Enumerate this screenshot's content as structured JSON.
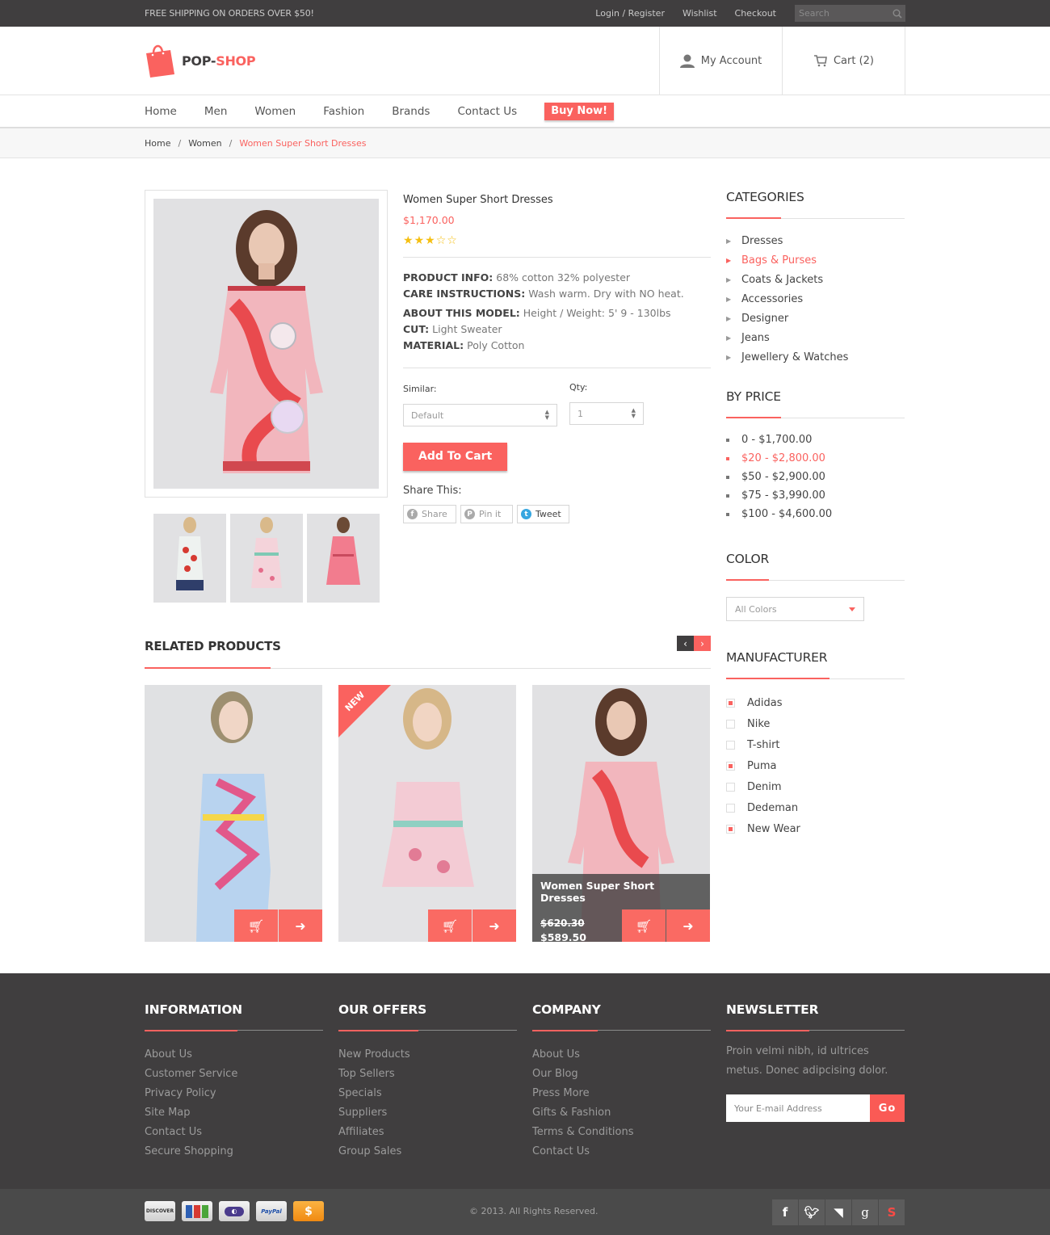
{
  "topbar": {
    "shipping": "FREE SHIPPING ON ORDERS OVER $50!",
    "links": [
      "Login / Register",
      "Wishlist",
      "Checkout"
    ],
    "search_placeholder": "Search"
  },
  "header": {
    "logo_dark": "POP-",
    "logo_accent": "SHOP",
    "account": "My Account",
    "cart": "Cart (2)"
  },
  "nav": {
    "items": [
      "Home",
      "Men",
      "Women",
      "Fashion",
      "Brands",
      "Contact Us"
    ],
    "buy_now": "Buy Now!"
  },
  "breadcrumb": [
    "Home",
    "Women",
    "Women Super Short Dresses"
  ],
  "product": {
    "title": "Women Super Short Dresses",
    "price": "$1,170.00",
    "rating": 3,
    "rating_max": 5,
    "specs": [
      {
        "label": "PRODUCT INFO:",
        "value": "68% cotton 32% polyester"
      },
      {
        "label": "CARE INSTRUCTIONS:",
        "value": "Wash warm. Dry with NO heat."
      },
      {
        "label": "ABOUT THIS MODEL:",
        "value": "Height / Weight: 5' 9 - 130lbs"
      },
      {
        "label": "CUT:",
        "value": "Light Sweater"
      },
      {
        "label": "MATERIAL:",
        "value": "Poly Cotton"
      }
    ],
    "similar_label": "Similar:",
    "similar_value": "Default",
    "qty_label": "Qty:",
    "qty_value": "1",
    "add_to_cart": "Add To Cart",
    "share_title": "Share This:",
    "share_buttons": [
      "Share",
      "Pin it",
      "Tweet"
    ]
  },
  "related": {
    "title": "RELATED PRODUCTS",
    "items": [
      {
        "badge": "",
        "title": "",
        "old_price": "",
        "price": ""
      },
      {
        "badge": "NEW",
        "title": "",
        "old_price": "",
        "price": ""
      },
      {
        "badge": "",
        "title": "Women Super Short Dresses",
        "old_price": "$620.30",
        "price": "$589.50"
      }
    ]
  },
  "sidebar": {
    "categories_title": "CATEGORIES",
    "categories": [
      "Dresses",
      "Bags & Purses",
      "Coats & Jackets",
      "Accessories",
      "Designer",
      "Jeans",
      "Jewellery & Watches"
    ],
    "categories_active": 1,
    "price_title": "BY PRICE",
    "prices": [
      "0 - $1,700.00",
      "$20 - $2,800.00",
      "$50 - $2,900.00",
      "$75 - $3,990.00",
      "$100 - $4,600.00"
    ],
    "price_active": 1,
    "color_title": "COLOR",
    "color_value": "All Colors",
    "manufacturer_title": "MANUFACTURER",
    "manufacturers": [
      {
        "name": "Adidas",
        "checked": true
      },
      {
        "name": "Nike",
        "checked": false
      },
      {
        "name": "T-shirt",
        "checked": false
      },
      {
        "name": "Puma",
        "checked": true
      },
      {
        "name": "Denim",
        "checked": false
      },
      {
        "name": "Dedeman",
        "checked": false
      },
      {
        "name": "New Wear",
        "checked": true
      }
    ]
  },
  "footer": {
    "information": {
      "title": "INFORMATION",
      "links": [
        "About Us",
        "Customer Service",
        "Privacy Policy",
        "Site Map",
        "Contact Us",
        "Secure Shopping"
      ]
    },
    "offers": {
      "title": "OUR OFFERS",
      "links": [
        "New Products",
        "Top Sellers",
        "Specials",
        "Suppliers",
        "Affiliates",
        "Group Sales"
      ]
    },
    "company": {
      "title": "COMPANY",
      "links": [
        "About Us",
        "Our Blog",
        "Press More",
        "Gifts & Fashion",
        "Terms & Conditions",
        "Contact Us"
      ]
    },
    "newsletter": {
      "title": "NEWSLETTER",
      "text": "Proin  velmi nibh, id ultrices metus. Donec adipcising dolor.",
      "placeholder": "Your E-mail Address",
      "button": "Go"
    },
    "payments": [
      "discover-card",
      "jcb-card",
      "diners-card",
      "paypal-card",
      "cash-card"
    ],
    "copyright": "© 2013. All Rights Reserved.",
    "social": [
      "facebook",
      "twitter",
      "rss",
      "google",
      "skype"
    ]
  },
  "colors": {
    "accent": "#fa625f",
    "dark": "#403e3f",
    "star": "#f5bf11"
  }
}
